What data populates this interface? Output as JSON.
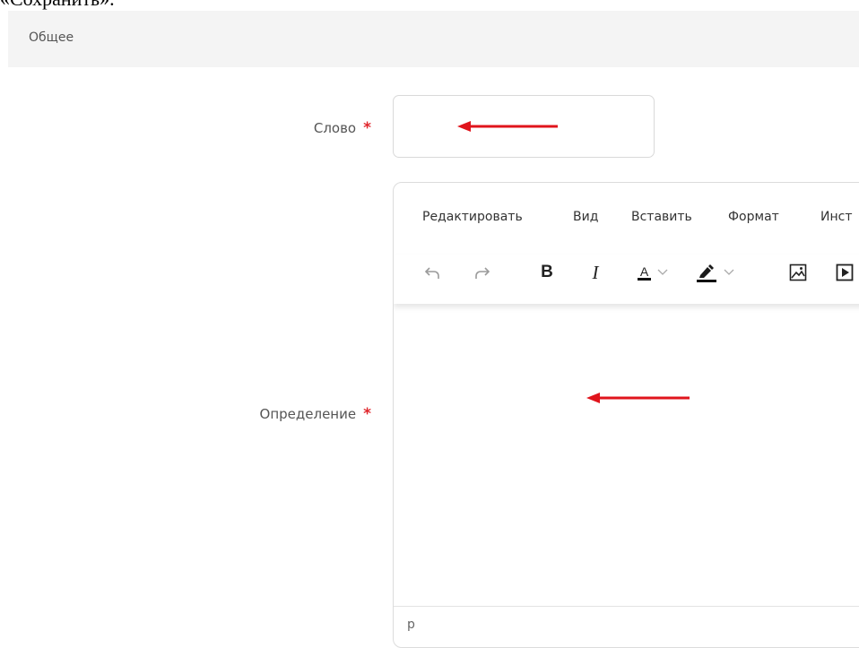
{
  "fragment_text": "«Сохранить».",
  "section": {
    "title": "Общее"
  },
  "form": {
    "word_label": "Слово",
    "definition_label": "Определение",
    "required_mark": "*"
  },
  "editor": {
    "menu": [
      "Редактировать",
      "Вид",
      "Вставить",
      "Формат",
      "Инст"
    ],
    "toolbar_icons": [
      "undo-icon",
      "redo-icon",
      "bold-icon",
      "italic-icon",
      "text-color-icon",
      "highlight-color-icon",
      "image-icon",
      "media-icon"
    ],
    "bold_glyph": "B",
    "italic_glyph": "I",
    "text_color_glyph": "A",
    "status_path": "p"
  },
  "colors": {
    "required": "#e0262c",
    "arrow": "#e0141c",
    "header_bg": "#f4f4f4"
  }
}
